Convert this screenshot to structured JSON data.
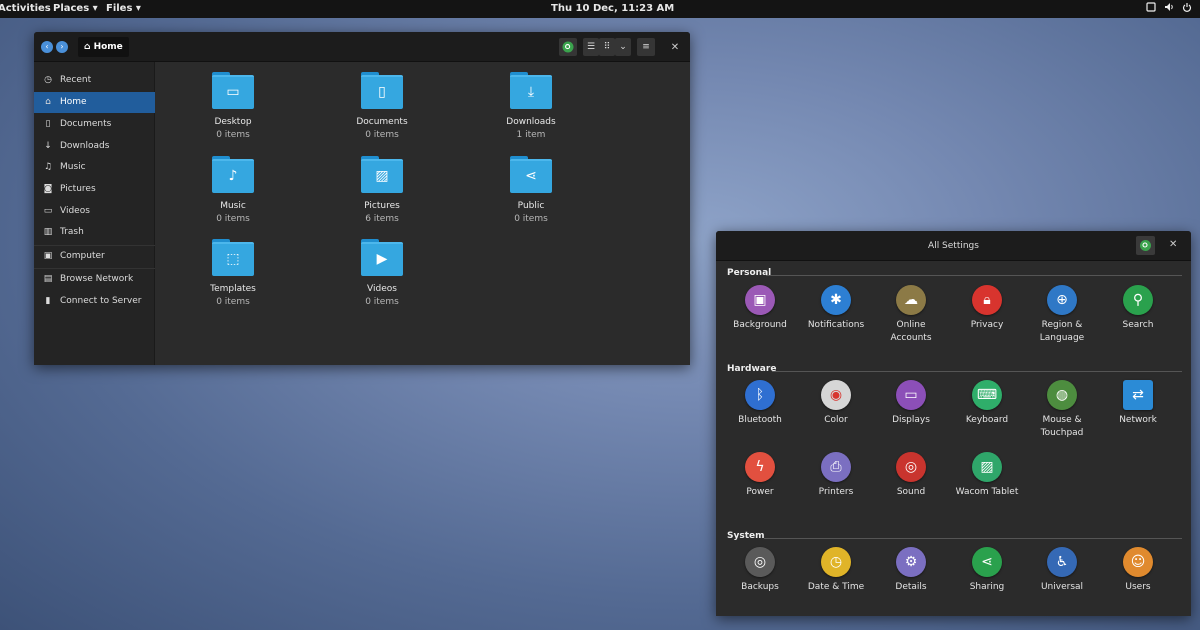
{
  "topbar": {
    "activities": "Activities",
    "places": "Places ▾",
    "files": "Files ▾",
    "clock": "Thu 10 Dec, 11:23 AM"
  },
  "files_window": {
    "path": "Home",
    "sidebar": [
      {
        "label": "Recent",
        "icon": "clock-icon"
      },
      {
        "label": "Home",
        "icon": "home-icon",
        "active": true
      },
      {
        "label": "Documents",
        "icon": "document-icon"
      },
      {
        "label": "Downloads",
        "icon": "download-icon"
      },
      {
        "label": "Music",
        "icon": "music-icon"
      },
      {
        "label": "Pictures",
        "icon": "camera-icon"
      },
      {
        "label": "Videos",
        "icon": "video-icon"
      },
      {
        "label": "Trash",
        "icon": "trash-icon"
      },
      {
        "label": "Computer",
        "icon": "computer-icon"
      },
      {
        "label": "Browse Network",
        "icon": "network-icon"
      },
      {
        "label": "Connect to Server",
        "icon": "server-icon"
      }
    ],
    "folders": [
      {
        "name": "Desktop",
        "count": "0 items",
        "icon": "desktop-icon"
      },
      {
        "name": "Documents",
        "count": "0 items",
        "icon": "document-icon"
      },
      {
        "name": "Downloads",
        "count": "1 item",
        "icon": "download-icon"
      },
      {
        "name": "Music",
        "count": "0 items",
        "icon": "music-icon"
      },
      {
        "name": "Pictures",
        "count": "6 items",
        "icon": "picture-icon"
      },
      {
        "name": "Public",
        "count": "0 items",
        "icon": "share-icon"
      },
      {
        "name": "Templates",
        "count": "0 items",
        "icon": "template-icon"
      },
      {
        "name": "Videos",
        "count": "0 items",
        "icon": "play-icon"
      }
    ]
  },
  "settings_window": {
    "title": "All Settings",
    "sections": {
      "personal": "Personal",
      "hardware": "Hardware",
      "system": "System"
    },
    "personal": [
      {
        "label": "Background",
        "color": "#9b59b6"
      },
      {
        "label": "Notifications",
        "color": "#2d7fd3"
      },
      {
        "label": "Online\nAccounts",
        "color": "#8c7a46"
      },
      {
        "label": "Privacy",
        "color": "#d8342e"
      },
      {
        "label": "Region &\nLanguage",
        "color": "#2f78c6"
      },
      {
        "label": "Search",
        "color": "#2aa14d"
      }
    ],
    "hardware": [
      {
        "label": "Bluetooth",
        "color": "#2f6fd1"
      },
      {
        "label": "Color",
        "color": "#d6d6d6"
      },
      {
        "label": "Displays",
        "color": "#8c4fb8"
      },
      {
        "label": "Keyboard",
        "color": "#2fae6a"
      },
      {
        "label": "Mouse &\nTouchpad",
        "color": "#4d8d3f"
      },
      {
        "label": "Network",
        "color": "#2b8bd6"
      },
      {
        "label": "Power",
        "color": "#e2503f"
      },
      {
        "label": "Printers",
        "color": "#7b6fc1"
      },
      {
        "label": "Sound",
        "color": "#c9342e"
      },
      {
        "label": "Wacom Tablet",
        "color": "#2fa66a"
      }
    ],
    "system": [
      {
        "label": "Backups",
        "color": "#5a5a5a"
      },
      {
        "label": "Date & Time",
        "color": "#e0b428"
      },
      {
        "label": "Details",
        "color": "#7b6fc1"
      },
      {
        "label": "Sharing",
        "color": "#2aa14d"
      },
      {
        "label": "Universal",
        "color": "#3569b5"
      },
      {
        "label": "Users",
        "color": "#e08a2e"
      }
    ]
  }
}
